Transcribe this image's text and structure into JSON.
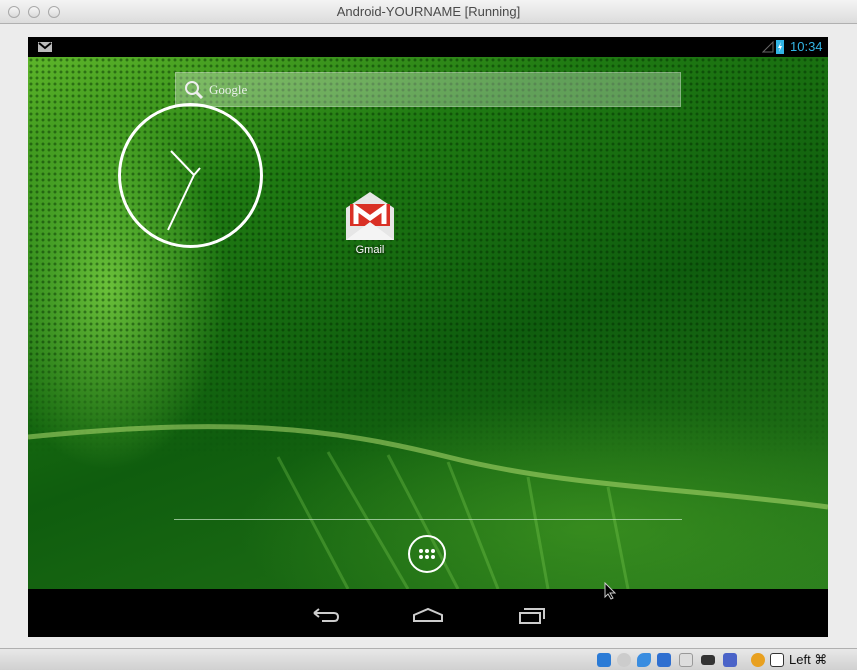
{
  "window": {
    "title": "Android-YOURNAME [Running]"
  },
  "statusbar": {
    "time": "10:34",
    "notification_icon": "gmail-icon",
    "signal_icon": "signal-icon",
    "battery_icon": "battery-charging-icon"
  },
  "search": {
    "placeholder": "Google"
  },
  "home": {
    "apps": [
      {
        "label": "Gmail",
        "icon": "gmail-icon"
      }
    ]
  },
  "navbar": {
    "buttons": [
      "back",
      "home",
      "recent-apps"
    ]
  },
  "vm_statusbar": {
    "host_key": "Left ⌘",
    "icons": [
      "hard-disk-icon",
      "optical-drive-icon",
      "usb-icon",
      "network-icon",
      "shared-folders-icon",
      "video-capture-icon",
      "cpu-icon",
      "mouse-integration-icon",
      "keyboard-capture-icon"
    ]
  },
  "colors": {
    "status_time": "#33b5e5",
    "gmail_red": "#d93025"
  }
}
